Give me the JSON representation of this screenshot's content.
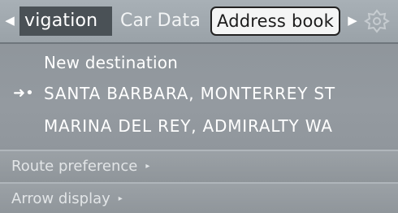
{
  "tabs": {
    "left_arrow": "◀",
    "right_arrow": "▶",
    "items": [
      "vigation",
      "Car Data",
      "Address book"
    ],
    "selected": "Address book",
    "settings_icon": "settings-knob-icon"
  },
  "destinations": {
    "new_destination": "New destination",
    "current_marker": "➜•",
    "items": [
      "SANTA BARBARA, MONTERREY ST",
      "MARINA DEL REY, ADMIRALTY WA"
    ]
  },
  "menu": {
    "route_preference": "Route preference",
    "arrow_display": "Arrow display",
    "submenu_arrow": "▸"
  },
  "colors": {
    "background": "#949aa0",
    "highlight_tab": "#4a5156",
    "selected_tab": "#f4f5f5"
  }
}
